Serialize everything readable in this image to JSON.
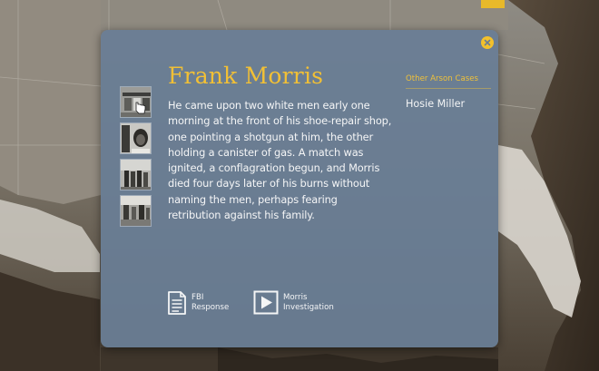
{
  "case": {
    "title": "Frank Morris",
    "story": "He came upon two white men early one morning at the front of his shoe-repair shop, one pointing a shotgun at him, the other holding a canister of gas. A match was ignited, a conflagration begun, and Morris died four days later of his burns without naming the men, perhaps fearing retribution against his family."
  },
  "sidebar": {
    "header": "Other Arson Cases",
    "items": [
      {
        "label": "Hosie Miller"
      }
    ]
  },
  "actions": {
    "fbi": {
      "line1": "FBI",
      "line2": "Response",
      "icon": "document-icon"
    },
    "investigation": {
      "line1": "Morris",
      "line2": "Investigation",
      "icon": "play-icon"
    }
  },
  "thumbnails": [
    {
      "icon": "photo-storefront"
    },
    {
      "icon": "photo-portrait"
    },
    {
      "icon": "photo-group"
    },
    {
      "icon": "photo-street"
    }
  ],
  "colors": {
    "accent": "#f2c035",
    "panel": "#697e96",
    "text": "#f4f5f6"
  }
}
